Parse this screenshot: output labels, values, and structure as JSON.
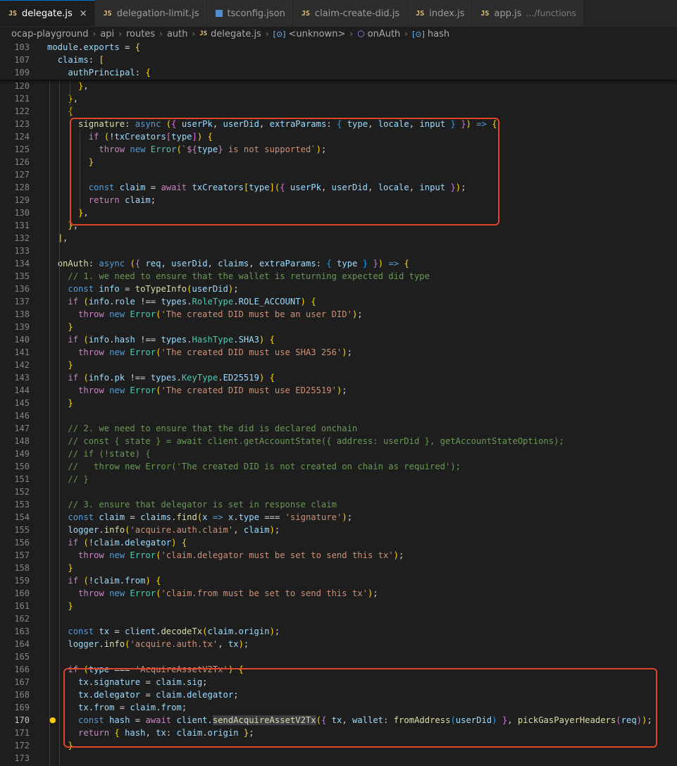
{
  "tabs": [
    {
      "label": "delegate.js",
      "icon": "js",
      "active": true
    },
    {
      "label": "delegation-limit.js",
      "icon": "js"
    },
    {
      "label": "tsconfig.json",
      "icon": "ts"
    },
    {
      "label": "claim-create-did.js",
      "icon": "js"
    },
    {
      "label": "index.js",
      "icon": "js"
    },
    {
      "label": "app.js",
      "icon": "js",
      "description": "…/functions"
    }
  ],
  "breadcrumb": [
    "ocap-playground",
    "api",
    "routes",
    "auth",
    "delegate.js",
    "<unknown>",
    "onAuth",
    "hash"
  ],
  "icons": {
    "js_label": "JS",
    "close": "×",
    "chevron": "›",
    "symbol": "[⊙]",
    "cube": "⬡"
  },
  "sticky": [
    {
      "num": "103",
      "text": "module.exports = {"
    },
    {
      "num": "107",
      "text": "  claims: ["
    },
    {
      "num": "109",
      "text": "    authPrincipal: {"
    }
  ],
  "lines": [
    {
      "num": "120",
      "text": "      },"
    },
    {
      "num": "121",
      "text": "    },"
    },
    {
      "num": "122",
      "text": "    {"
    },
    {
      "num": "123",
      "text": "      signature: async ({ userPk, userDid, extraParams: { type, locale, input } }) => {"
    },
    {
      "num": "124",
      "text": "        if (!txCreators[type]) {"
    },
    {
      "num": "125",
      "text": "          throw new Error(`${type} is not supported`);"
    },
    {
      "num": "126",
      "text": "        }"
    },
    {
      "num": "127",
      "text": ""
    },
    {
      "num": "128",
      "text": "        const claim = await txCreators[type]({ userPk, userDid, locale, input });"
    },
    {
      "num": "129",
      "text": "        return claim;"
    },
    {
      "num": "130",
      "text": "      },"
    },
    {
      "num": "131",
      "text": "    },"
    },
    {
      "num": "132",
      "text": "  ],"
    },
    {
      "num": "133",
      "text": ""
    },
    {
      "num": "134",
      "text": "  onAuth: async ({ req, userDid, claims, extraParams: { type } }) => {"
    },
    {
      "num": "135",
      "text": "    // 1. we need to ensure that the wallet is returning expected did type"
    },
    {
      "num": "136",
      "text": "    const info = toTypeInfo(userDid);"
    },
    {
      "num": "137",
      "text": "    if (info.role !== types.RoleType.ROLE_ACCOUNT) {"
    },
    {
      "num": "138",
      "text": "      throw new Error('The created DID must be an user DID');"
    },
    {
      "num": "139",
      "text": "    }"
    },
    {
      "num": "140",
      "text": "    if (info.hash !== types.HashType.SHA3) {"
    },
    {
      "num": "141",
      "text": "      throw new Error('The created DID must use SHA3 256');"
    },
    {
      "num": "142",
      "text": "    }"
    },
    {
      "num": "143",
      "text": "    if (info.pk !== types.KeyType.ED25519) {"
    },
    {
      "num": "144",
      "text": "      throw new Error('The created DID must use ED25519');"
    },
    {
      "num": "145",
      "text": "    }"
    },
    {
      "num": "146",
      "text": ""
    },
    {
      "num": "147",
      "text": "    // 2. we need to ensure that the did is declared onchain"
    },
    {
      "num": "148",
      "text": "    // const { state } = await client.getAccountState({ address: userDid }, getAccountStateOptions);"
    },
    {
      "num": "149",
      "text": "    // if (!state) {"
    },
    {
      "num": "150",
      "text": "    //   throw new Error('The created DID is not created on chain as required');"
    },
    {
      "num": "151",
      "text": "    // }"
    },
    {
      "num": "152",
      "text": ""
    },
    {
      "num": "153",
      "text": "    // 3. ensure that delegator is set in response claim"
    },
    {
      "num": "154",
      "text": "    const claim = claims.find(x => x.type === 'signature');"
    },
    {
      "num": "155",
      "text": "    logger.info('acquire.auth.claim', claim);"
    },
    {
      "num": "156",
      "text": "    if (!claim.delegator) {"
    },
    {
      "num": "157",
      "text": "      throw new Error('claim.delegator must be set to send this tx');"
    },
    {
      "num": "158",
      "text": "    }"
    },
    {
      "num": "159",
      "text": "    if (!claim.from) {"
    },
    {
      "num": "160",
      "text": "      throw new Error('claim.from must be set to send this tx');"
    },
    {
      "num": "161",
      "text": "    }"
    },
    {
      "num": "162",
      "text": ""
    },
    {
      "num": "163",
      "text": "    const tx = client.decodeTx(claim.origin);"
    },
    {
      "num": "164",
      "text": "    logger.info('acquire.auth.tx', tx);"
    },
    {
      "num": "165",
      "text": ""
    },
    {
      "num": "166",
      "text": "    if (type === 'AcquireAssetV2Tx') {"
    },
    {
      "num": "167",
      "text": "      tx.signature = claim.sig;"
    },
    {
      "num": "168",
      "text": "      tx.delegator = claim.delegator;"
    },
    {
      "num": "169",
      "text": "      tx.from = claim.from;"
    },
    {
      "num": "170",
      "text": "      const hash = await client.sendAcquireAssetV2Tx({ tx, wallet: fromAddress(userDid) }, pickGasPayerHeaders(req));"
    },
    {
      "num": "171",
      "text": "      return { hash, tx: claim.origin };"
    },
    {
      "num": "172",
      "text": "    }"
    },
    {
      "num": "173",
      "text": ""
    }
  ],
  "current_line": "170",
  "colors": {
    "highlight_box": "#e0442b",
    "background": "#1e1e1e",
    "active_tab_border": "#0078d4"
  }
}
